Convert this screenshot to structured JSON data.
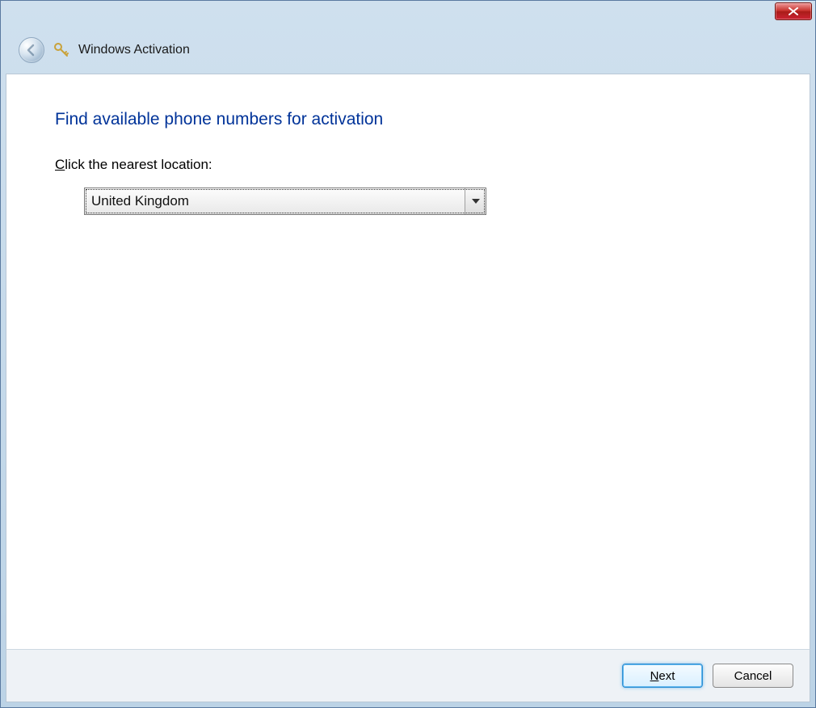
{
  "window": {
    "title": "Windows Activation"
  },
  "page": {
    "heading": "Find available phone numbers for activation",
    "instruction_prefix": "C",
    "instruction_rest": "lick the nearest location:"
  },
  "dropdown": {
    "selected": "United Kingdom"
  },
  "buttons": {
    "next_prefix": "N",
    "next_rest": "ext",
    "cancel": "Cancel"
  }
}
